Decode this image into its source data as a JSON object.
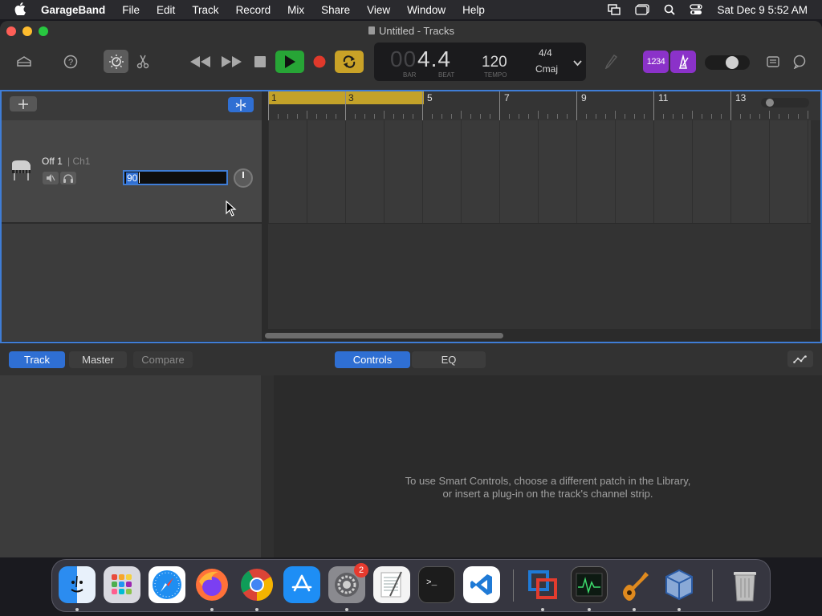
{
  "menubar": {
    "app": "GarageBand",
    "items": [
      "File",
      "Edit",
      "Track",
      "Record",
      "Mix",
      "Share",
      "View",
      "Window",
      "Help"
    ],
    "clock": "Sat Dec 9  5:52 AM"
  },
  "window": {
    "title": "Untitled - Tracks"
  },
  "lcd": {
    "position": "4.4",
    "position_dim": "00",
    "bar_label": "BAR",
    "beat_label": "BEAT",
    "tempo": "120",
    "tempo_label": "TEMPO",
    "signature": "4/4",
    "key": "Cmaj"
  },
  "toolbar": {
    "count_in_label": "1234"
  },
  "track": {
    "name": "Off 1",
    "channel": "| Ch1",
    "input_value": "90"
  },
  "ruler": {
    "marks": [
      "1",
      "3",
      "5",
      "7",
      "9",
      "11",
      "13"
    ]
  },
  "bottom": {
    "tabs": [
      "Track",
      "Master",
      "Compare"
    ],
    "center_tabs": [
      "Controls",
      "EQ"
    ],
    "message_line1": "To use Smart Controls, choose a different patch in the Library,",
    "message_line2": "or insert a plug-in on the track's channel strip."
  },
  "dock": {
    "apps": [
      "Finder",
      "Launchpad",
      "Safari",
      "Firefox",
      "Chrome",
      "App Store",
      "System Settings",
      "TextEdit",
      "Terminal",
      "VS Code",
      "Parallels",
      "Activity Monitor",
      "GarageBand",
      "VirtualBox",
      "Trash"
    ],
    "settings_badge": "2"
  },
  "colors": {
    "accent": "#2f6fd3",
    "play": "#27a536",
    "record": "#e0392b",
    "cycle": "#c9a227",
    "region": "#c3a229",
    "purple": "#8b32c9"
  }
}
